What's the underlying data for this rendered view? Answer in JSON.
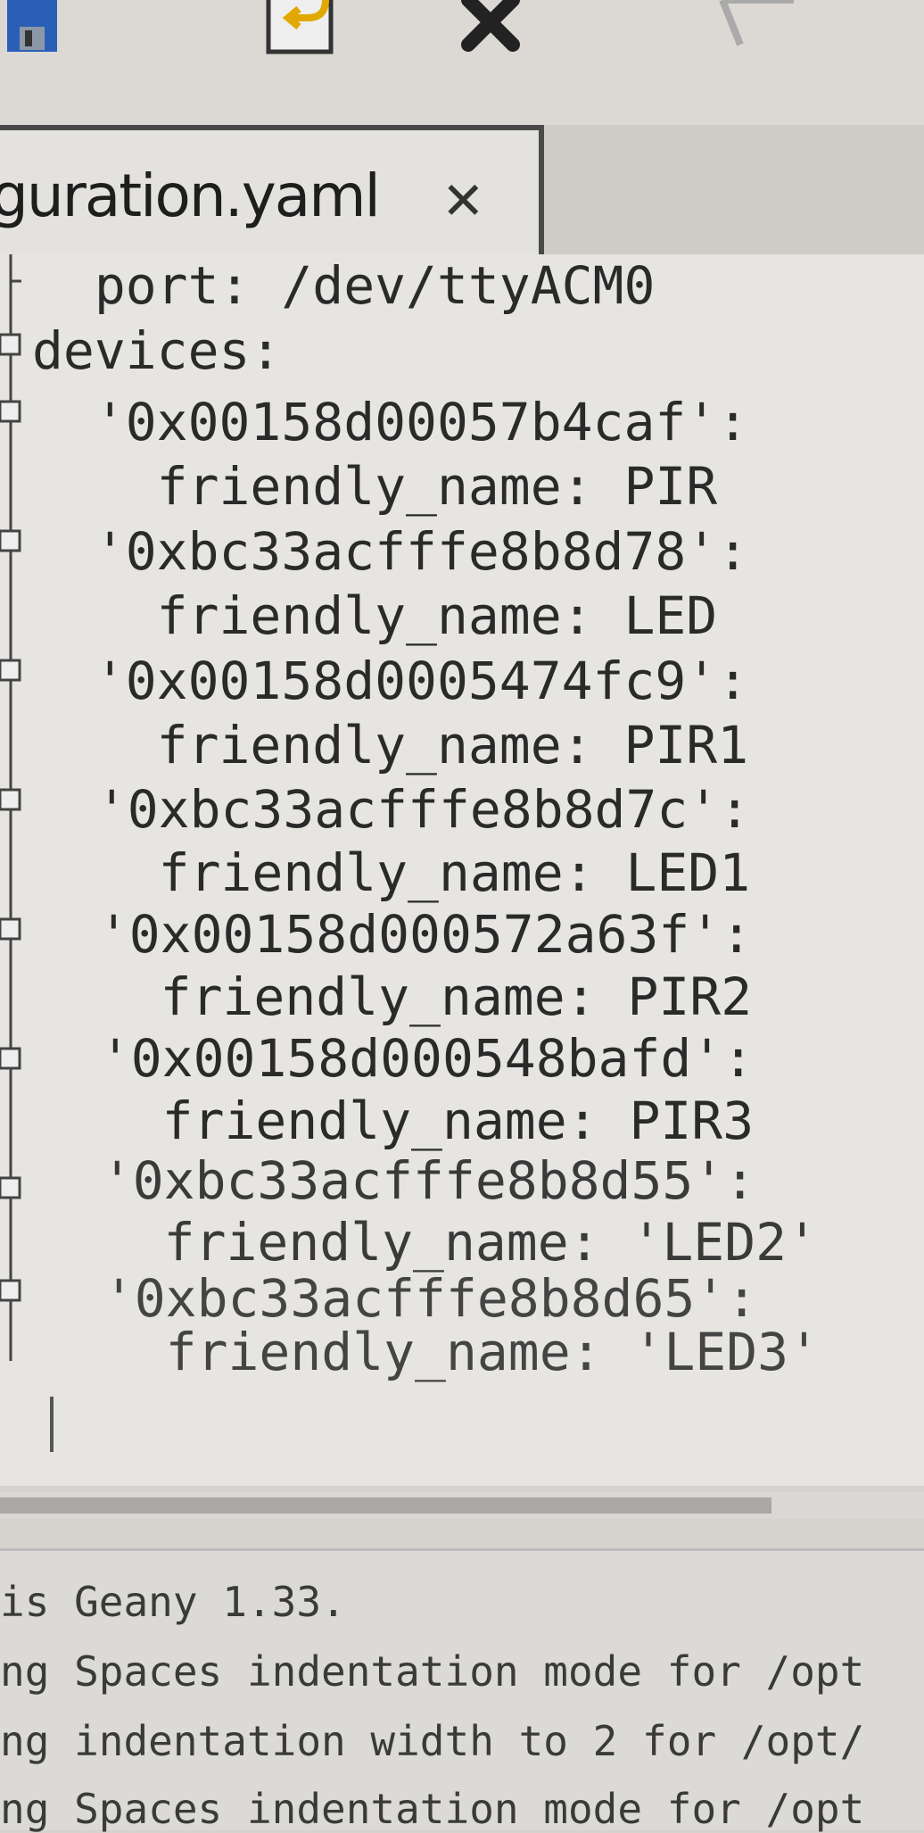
{
  "toolbar": {
    "icons": [
      "save-icon",
      "revert-icon",
      "close-icon",
      "back-icon"
    ]
  },
  "tab": {
    "label": "guration.yaml",
    "close": "✕"
  },
  "editor": {
    "lines": [
      "  port: /dev/ttyACM0",
      "devices:",
      "  '0x00158d00057b4caf':",
      "    friendly_name: PIR",
      "  '0xbc33acfffe8b8d78':",
      "    friendly_name: LED",
      "  '0x00158d0005474fc9':",
      "    friendly_name: PIR1",
      "  '0xbc33acfffe8b8d7c':",
      "    friendly_name: LED1",
      "  '0x00158d000572a63f':",
      "    friendly_name: PIR2",
      "  '0x00158d000548bafd':",
      "    friendly_name: PIR3",
      "  '0xbc33acfffe8b8d55':",
      "    friendly_name: 'LED2'",
      "  '0xbc33acfffe8b8d65':",
      "    friendly_name: 'LED3'"
    ]
  },
  "messages": [
    "is Geany 1.33.",
    "ng Spaces indentation mode for /opt",
    "ng indentation width to 2 for /opt/",
    "ng Spaces indentation mode for /opt"
  ],
  "colors": {
    "accent_save": "#2a5fb8",
    "accent_revert": "#e0a800"
  }
}
